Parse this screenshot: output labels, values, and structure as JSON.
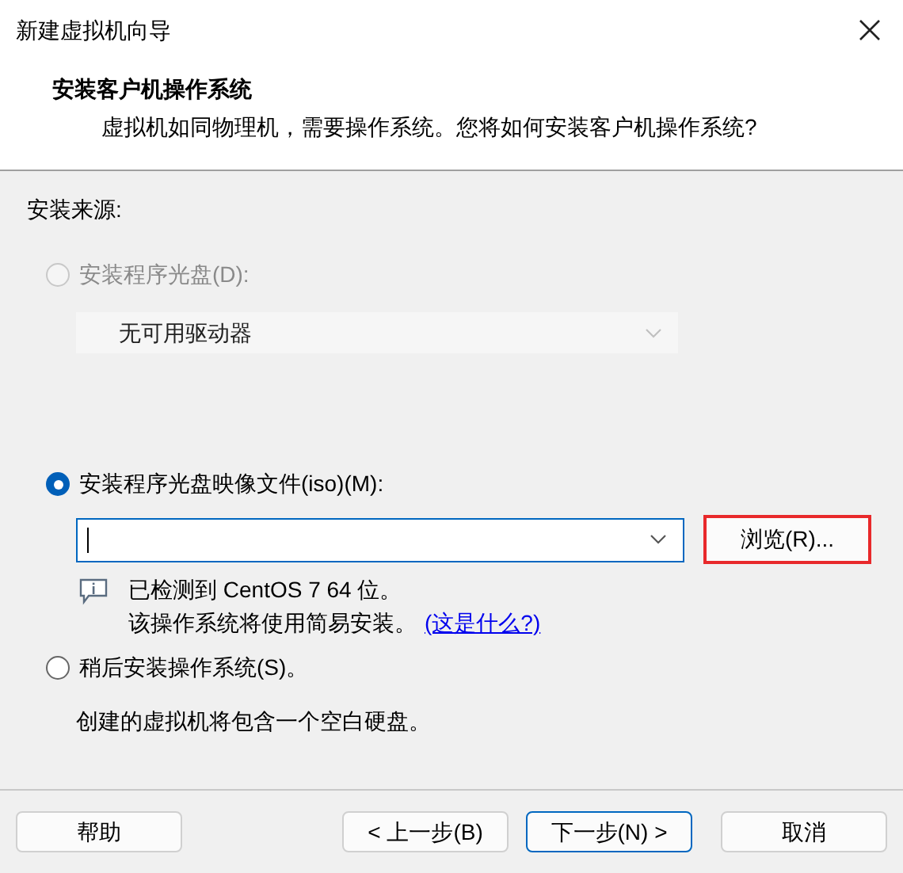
{
  "window": {
    "title": "新建虚拟机向导"
  },
  "header": {
    "title": "安装客户机操作系统",
    "subtitle": "虚拟机如同物理机，需要操作系统。您将如何安装客户机操作系统?"
  },
  "source_label": "安装来源:",
  "options": [
    {
      "kind": "disc",
      "label": "安装程序光盘(D):",
      "selected": false,
      "disabled": true,
      "dropdown": {
        "value": "无可用驱动器",
        "disabled": true
      }
    },
    {
      "kind": "iso",
      "label": "安装程序光盘映像文件(iso)(M):",
      "selected": true,
      "disabled": false,
      "browse": {
        "label": "浏览(R)...",
        "highlighted": true
      },
      "info": {
        "line1": "已检测到 CentOS 7 64 位。",
        "line2": "该操作系统将使用简易安装。",
        "link": "(这是什么?)"
      }
    },
    {
      "kind": "later",
      "label": "稍后安装操作系统(S)。",
      "selected": false,
      "disabled": false,
      "description": "创建的虚拟机将包含一个空白硬盘。"
    }
  ],
  "buttons": [
    {
      "label": "帮助",
      "primary": false
    },
    {
      "label": "< 上一步(B)",
      "primary": false
    },
    {
      "label": "下一步(N) >",
      "primary": true
    },
    {
      "label": "取消",
      "primary": false
    }
  ]
}
